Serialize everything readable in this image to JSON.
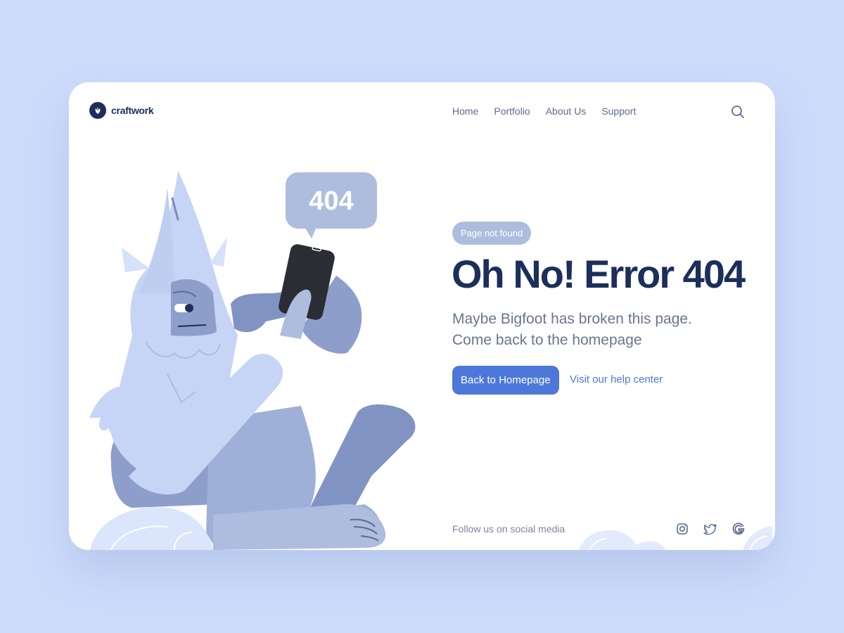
{
  "brand": {
    "name": "craftwork",
    "logo_icon": "leaf-logo-icon"
  },
  "nav": {
    "items": [
      {
        "label": "Home"
      },
      {
        "label": "Portfolio"
      },
      {
        "label": "About Us"
      },
      {
        "label": "Support"
      }
    ],
    "search_icon": "search-icon"
  },
  "illustration": {
    "speech_bubble_text": "404",
    "subject": "bigfoot-using-phone"
  },
  "main": {
    "badge": "Page not found",
    "title": "Oh No! Error 404",
    "description_line1": "Maybe Bigfoot has broken this page.",
    "description_line2": "Come back to the homepage",
    "primary_button": "Back to Homepage",
    "secondary_link": "Visit our help center"
  },
  "footer": {
    "follow_text": "Follow us on social media",
    "social_icons": [
      "instagram-icon",
      "twitter-icon",
      "google-icon"
    ]
  },
  "colors": {
    "background": "#cddcfb",
    "card": "#ffffff",
    "heading": "#1c2e5a",
    "accent": "#4d78d9",
    "badge": "#aebdde"
  }
}
